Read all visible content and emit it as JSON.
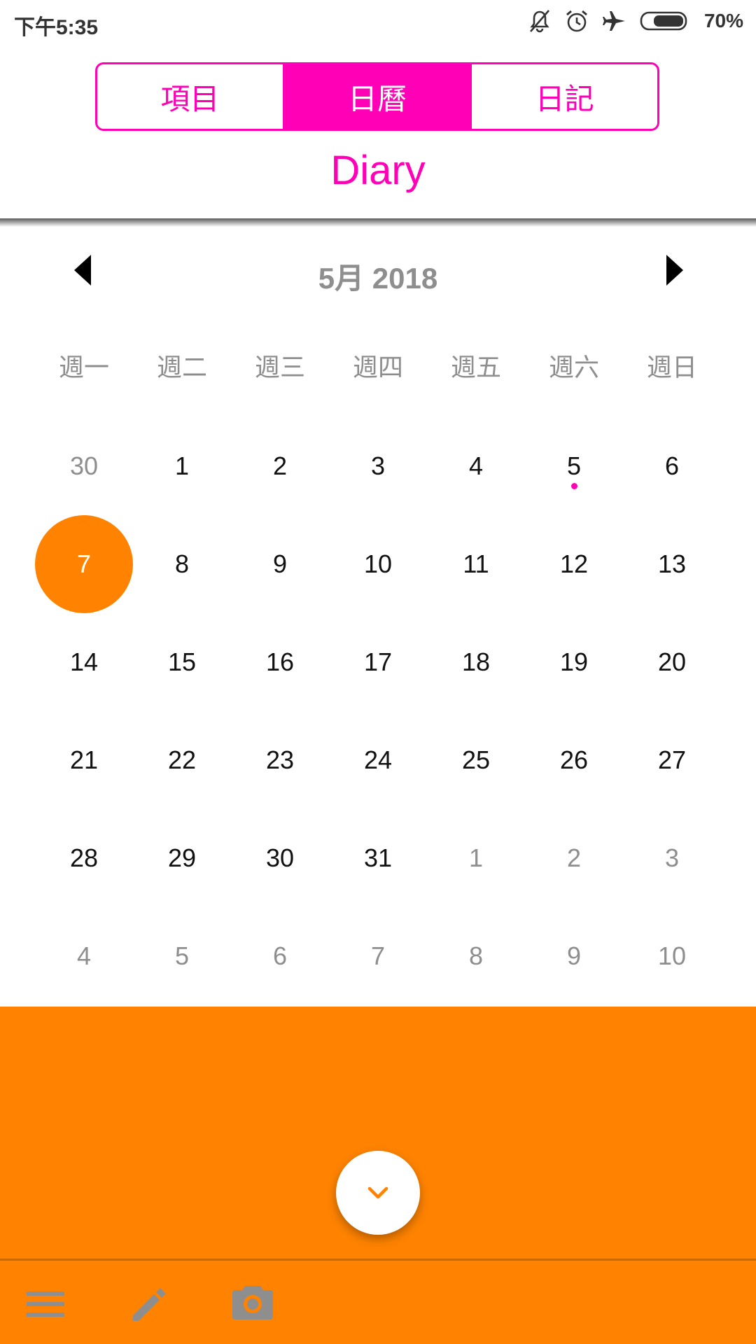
{
  "status_bar": {
    "time": "下午5:35",
    "battery": "70%",
    "icons": [
      "bell-off-icon",
      "alarm-icon",
      "airplane-icon",
      "battery-icon"
    ]
  },
  "tabs": [
    {
      "label": "項目",
      "active": false
    },
    {
      "label": "日曆",
      "active": true
    },
    {
      "label": "日記",
      "active": false
    }
  ],
  "title": "Diary",
  "calendar": {
    "month_label": "5月 2018",
    "weekdays": [
      "週一",
      "週二",
      "週三",
      "週四",
      "週五",
      "週六",
      "週日"
    ],
    "days": [
      {
        "label": "30",
        "outside": true
      },
      {
        "label": "1"
      },
      {
        "label": "2"
      },
      {
        "label": "3"
      },
      {
        "label": "4"
      },
      {
        "label": "5",
        "has_event": true
      },
      {
        "label": "6"
      },
      {
        "label": "7",
        "selected": true
      },
      {
        "label": "8"
      },
      {
        "label": "9"
      },
      {
        "label": "10"
      },
      {
        "label": "11"
      },
      {
        "label": "12"
      },
      {
        "label": "13"
      },
      {
        "label": "14"
      },
      {
        "label": "15"
      },
      {
        "label": "16"
      },
      {
        "label": "17"
      },
      {
        "label": "18"
      },
      {
        "label": "19"
      },
      {
        "label": "20"
      },
      {
        "label": "21"
      },
      {
        "label": "22"
      },
      {
        "label": "23"
      },
      {
        "label": "24"
      },
      {
        "label": "25"
      },
      {
        "label": "26"
      },
      {
        "label": "27"
      },
      {
        "label": "28"
      },
      {
        "label": "29"
      },
      {
        "label": "30"
      },
      {
        "label": "31"
      },
      {
        "label": "1",
        "outside": true
      },
      {
        "label": "2",
        "outside": true
      },
      {
        "label": "3",
        "outside": true
      },
      {
        "label": "4",
        "outside": true
      },
      {
        "label": "5",
        "outside": true
      },
      {
        "label": "6",
        "outside": true
      },
      {
        "label": "7",
        "outside": true
      },
      {
        "label": "8",
        "outside": true
      },
      {
        "label": "9",
        "outside": true
      },
      {
        "label": "10",
        "outside": true
      }
    ]
  },
  "colors": {
    "accent_pink": "#ff00b7",
    "accent_orange": "#ff8300",
    "muted_text": "#8e8e8e"
  },
  "icons": {
    "prev": "chevron-left-icon",
    "next": "chevron-right-icon",
    "fab": "chevron-down-icon",
    "bottom": [
      "menu-icon",
      "pencil-icon",
      "camera-icon"
    ]
  }
}
